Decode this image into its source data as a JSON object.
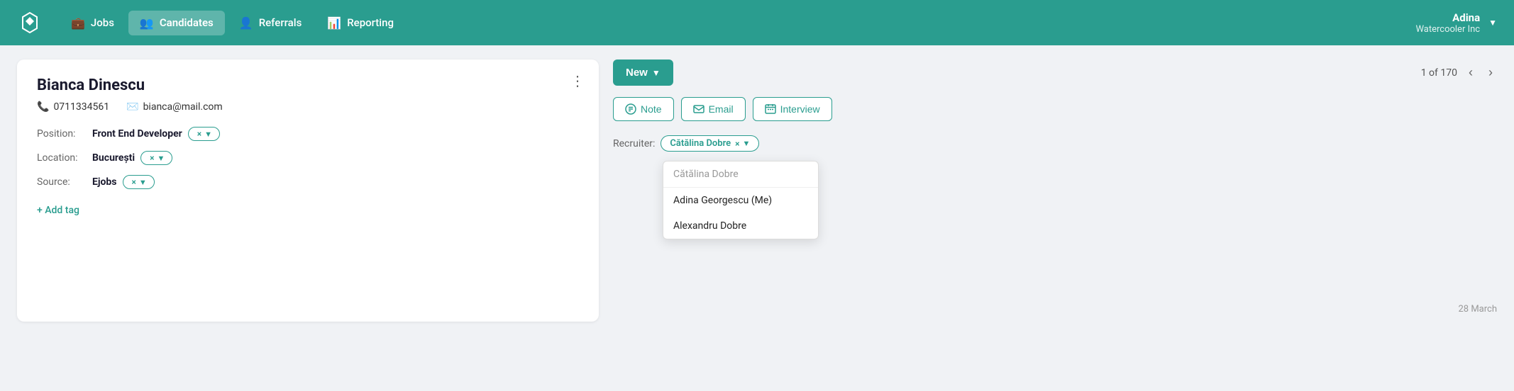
{
  "navbar": {
    "logo_label": "Logo",
    "items": [
      {
        "id": "jobs",
        "label": "Jobs",
        "icon": "💼",
        "active": false
      },
      {
        "id": "candidates",
        "label": "Candidates",
        "icon": "👥",
        "active": true
      },
      {
        "id": "referrals",
        "label": "Referrals",
        "icon": "👤",
        "active": false
      },
      {
        "id": "reporting",
        "label": "Reporting",
        "icon": "📊",
        "active": false
      }
    ],
    "user": {
      "name": "Adina",
      "company": "Watercooler Inc"
    }
  },
  "candidate": {
    "name": "Bianca Dinescu",
    "phone": "0711334561",
    "email": "bianca@mail.com",
    "position_label": "Position:",
    "position_value": "Front End Developer",
    "location_label": "Location:",
    "location_value": "București",
    "source_label": "Source:",
    "source_value": "Ejobs",
    "add_tag_label": "+ Add tag",
    "more_menu_label": "⋮"
  },
  "actions": {
    "new_button": "New",
    "pagination_text": "1 of 170",
    "note_button": "Note",
    "email_button": "Email",
    "interview_button": "Interview",
    "recruiter_label": "Recruiter:",
    "recruiter_name": "Cătălina Dobre"
  },
  "dropdown": {
    "search_placeholder": "Cătălina Dobre",
    "items": [
      "Adina Georgescu (Me)",
      "Alexandru Dobre"
    ]
  },
  "date_footer": "28 March"
}
